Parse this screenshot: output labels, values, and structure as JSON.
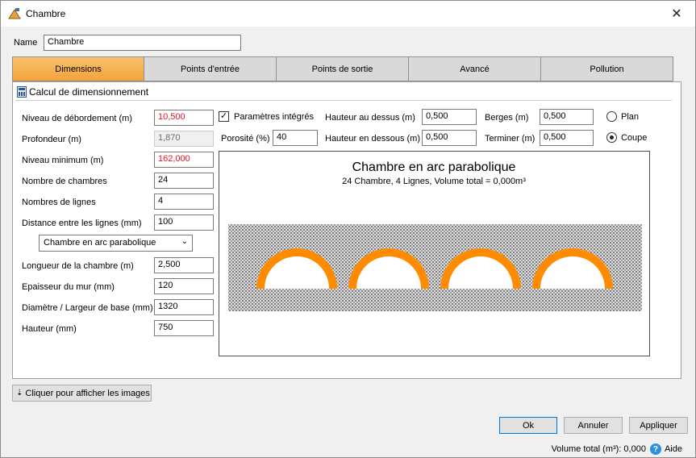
{
  "window": {
    "title": "Chambre",
    "close_glyph": "✕"
  },
  "name_field": {
    "label": "Name",
    "value": "Chambre"
  },
  "tabs": [
    {
      "label": "Dimensions",
      "active": true
    },
    {
      "label": "Points d'entrée",
      "active": false
    },
    {
      "label": "Points de sortie",
      "active": false
    },
    {
      "label": "Avancé",
      "active": false
    },
    {
      "label": "Pollution",
      "active": false
    }
  ],
  "section": {
    "title": "Calcul de dimensionnement",
    "icon": "calculator-icon"
  },
  "left_fields": [
    {
      "label": "Niveau de débordement (m)",
      "value": "10,500",
      "state": "error"
    },
    {
      "label": "Profondeur (m)",
      "value": "1,870",
      "state": "disabled"
    },
    {
      "label": "Niveau minimum (m)",
      "value": "162,000",
      "state": "error"
    },
    {
      "label": "Nombre de chambres",
      "value": "24",
      "state": "normal"
    },
    {
      "label": "Nombres de lignes",
      "value": "4",
      "state": "normal"
    },
    {
      "label": "Distance entre les lignes (mm)",
      "value": "100",
      "state": "normal"
    }
  ],
  "chamber_type": {
    "selected": "Chambre en arc parabolique"
  },
  "dimension_fields": [
    {
      "label": "Longueur de la chambre (m)",
      "value": "2,500"
    },
    {
      "label": "Epaisseur du mur (mm)",
      "value": "120"
    },
    {
      "label": "Diamètre / Largeur de base (mm)",
      "value": "1320"
    },
    {
      "label": "Hauteur (mm)",
      "value": "750"
    }
  ],
  "integrated_params": {
    "label": "Paramètres intégrés",
    "checked": true,
    "check_glyph": "✓"
  },
  "porosity": {
    "label": "Porosité (%)",
    "value": "40"
  },
  "height_above": {
    "label": "Hauteur au dessus (m)",
    "value": "0,500"
  },
  "height_below": {
    "label": "Hauteur en dessous (m)",
    "value": "0,500"
  },
  "banks": {
    "label": "Berges (m)",
    "value": "0,500"
  },
  "finish": {
    "label": "Terminer (m)",
    "value": "0,500"
  },
  "view_mode": {
    "options": [
      {
        "label": "Plan",
        "checked": false
      },
      {
        "label": "Coupe",
        "checked": true
      }
    ]
  },
  "preview": {
    "title": "Chambre en arc parabolique",
    "subtitle": "24 Chambre, 4 Lignes, Volume total = 0,000m³",
    "arch_count": 4,
    "colors": {
      "gravel": "#c8c8c8",
      "arch": "#ff8c00"
    }
  },
  "images_button": {
    "label": "Cliquer pour afficher les images",
    "icon": "double-chevron-down-icon"
  },
  "footer_buttons": {
    "ok": "Ok",
    "cancel": "Annuler",
    "apply": "Appliquer"
  },
  "status": {
    "volume": "Volume total (m³): 0,000",
    "help": "Aide",
    "help_glyph": "?"
  }
}
